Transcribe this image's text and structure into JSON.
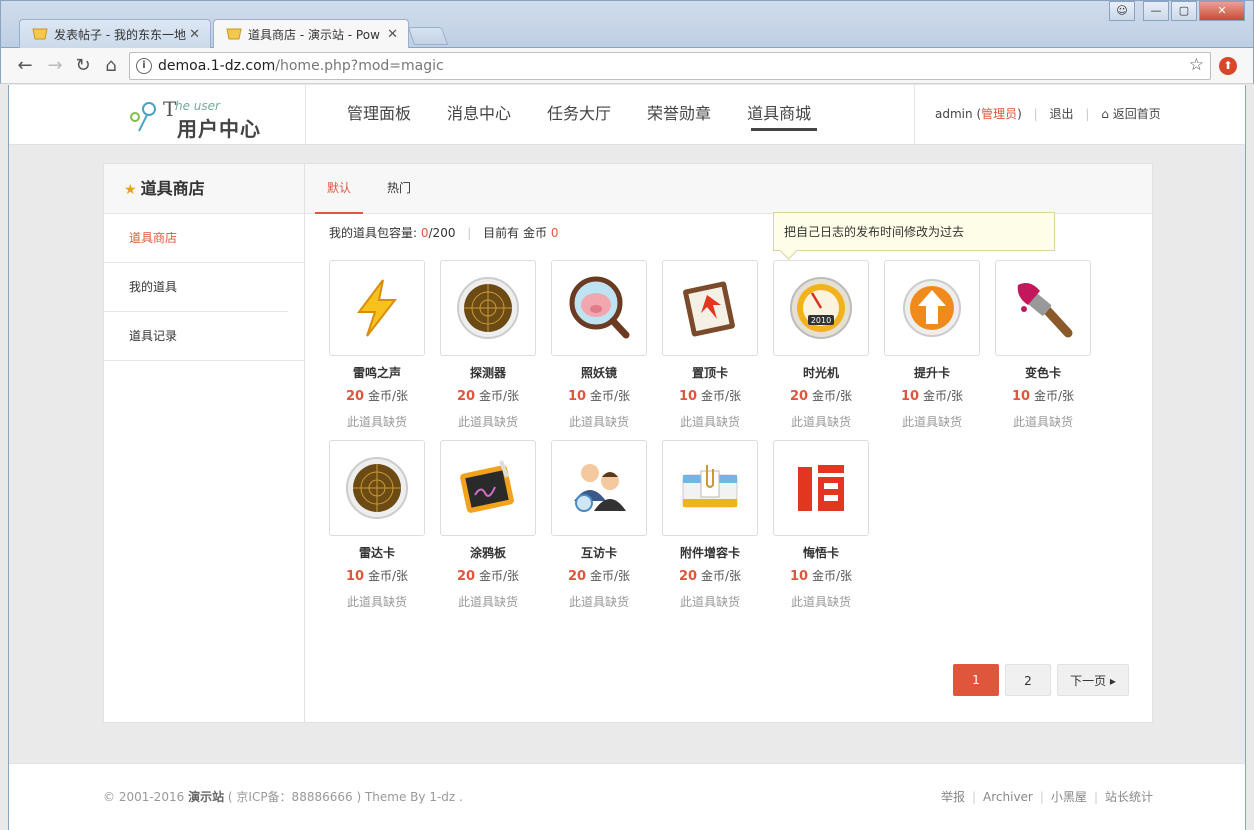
{
  "browser": {
    "tabs": [
      {
        "title": "发表帖子 - 我的东东一地",
        "active": false
      },
      {
        "title": "道具商店 - 演示站 - Pow",
        "active": true
      }
    ],
    "url_host": "demoa.1-dz.com",
    "url_path": "/home.php?mod=magic",
    "colors": {
      "chrome_bg": "#cfdcec",
      "close_button": "#c94b35"
    }
  },
  "header": {
    "logo": {
      "the": "T",
      "he_user": "he user",
      "cn": "用户中心"
    },
    "nav": [
      "管理面板",
      "消息中心",
      "任务大厅",
      "荣誉勋章",
      "道具商城"
    ],
    "current_nav": "道具商城",
    "user": {
      "name": "admin",
      "role_prefix": "(",
      "role": "管理员",
      "role_suffix": ")",
      "logout": "退出",
      "home": "返回首页"
    }
  },
  "sidebar": {
    "title": "道具商店",
    "items": [
      {
        "label": "道具商店",
        "current": true
      },
      {
        "label": "我的道具",
        "current": false
      },
      {
        "label": "道具记录",
        "current": false
      }
    ]
  },
  "content": {
    "tabs": [
      {
        "label": "默认",
        "current": true
      },
      {
        "label": "热门",
        "current": false
      }
    ],
    "stats": {
      "capacity_label": "我的道具包容量:",
      "capacity_value": "0",
      "capacity_total": "/200",
      "coins_label": "目前有 金币",
      "coins_value": "0"
    },
    "tooltip": "把自己日志的发布时间修改为过去",
    "unit": "金币/张",
    "stock_text": "此道具缺货",
    "items": [
      {
        "name": "雷鸣之声",
        "price": "20",
        "icon": "lightning-icon"
      },
      {
        "name": "探测器",
        "price": "20",
        "icon": "radar-icon"
      },
      {
        "name": "照妖镜",
        "price": "10",
        "icon": "magnifier-pig-icon"
      },
      {
        "name": "置顶卡",
        "price": "10",
        "icon": "sticky-card-icon"
      },
      {
        "name": "时光机",
        "price": "20",
        "icon": "time-machine-icon"
      },
      {
        "name": "提升卡",
        "price": "10",
        "icon": "up-arrow-icon"
      },
      {
        "name": "变色卡",
        "price": "10",
        "icon": "paint-brush-icon"
      },
      {
        "name": "雷达卡",
        "price": "10",
        "icon": "radar-icon"
      },
      {
        "name": "涂鸦板",
        "price": "20",
        "icon": "graffiti-board-icon"
      },
      {
        "name": "互访卡",
        "price": "20",
        "icon": "visit-users-icon"
      },
      {
        "name": "附件增容卡",
        "price": "20",
        "icon": "attachment-icon"
      },
      {
        "name": "悔悟卡",
        "price": "10",
        "icon": "repent-icon"
      }
    ],
    "pager": {
      "pages": [
        "1",
        "2"
      ],
      "current": "1",
      "next": "下一页"
    }
  },
  "footer": {
    "copy_prefix": "© 2001-2016",
    "site": "演示站",
    "icp": "( 京ICP备：88886666 )",
    "theme": "Theme By 1-dz .",
    "links": [
      "举报",
      "Archiver",
      "小黑屋",
      "站长统计"
    ]
  },
  "colors": {
    "accent": "#e0563c",
    "tooltip_bg": "#fefde8"
  }
}
